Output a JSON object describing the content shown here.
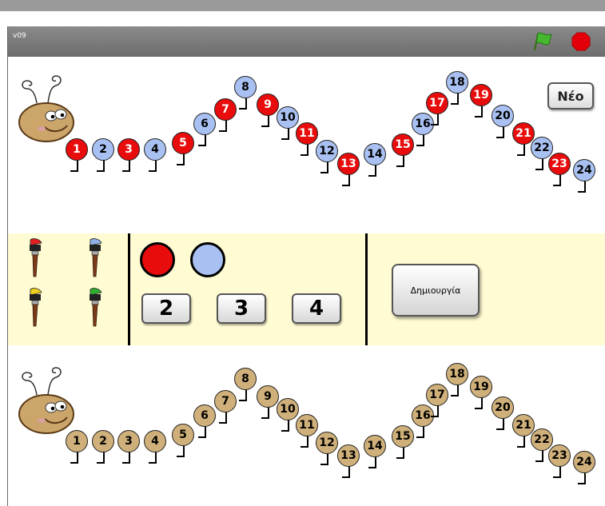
{
  "window": {
    "version": "v09"
  },
  "controls": {
    "green_flag_icon": "green-flag-icon",
    "stop_icon": "stop-sign-icon",
    "neo_label": "Νέο"
  },
  "palette": {
    "brush_colors": [
      "#e02020",
      "#8fb0e8",
      "#f0d020",
      "#30b030"
    ],
    "swatch_colors": [
      "#e80c0c",
      "#a9c1f2"
    ],
    "number_buttons": [
      "2",
      "3",
      "4"
    ],
    "create_label": "Δημιουργία"
  },
  "caterpillar_top": {
    "segments": [
      {
        "n": "1",
        "color": "red"
      },
      {
        "n": "2",
        "color": "blue"
      },
      {
        "n": "3",
        "color": "red"
      },
      {
        "n": "4",
        "color": "blue"
      },
      {
        "n": "5",
        "color": "red"
      },
      {
        "n": "6",
        "color": "blue"
      },
      {
        "n": "7",
        "color": "red"
      },
      {
        "n": "8",
        "color": "blue"
      },
      {
        "n": "9",
        "color": "red"
      },
      {
        "n": "10",
        "color": "blue"
      },
      {
        "n": "11",
        "color": "red"
      },
      {
        "n": "12",
        "color": "blue"
      },
      {
        "n": "13",
        "color": "red"
      },
      {
        "n": "14",
        "color": "blue"
      },
      {
        "n": "15",
        "color": "red"
      },
      {
        "n": "16",
        "color": "blue"
      },
      {
        "n": "17",
        "color": "red"
      },
      {
        "n": "18",
        "color": "blue"
      },
      {
        "n": "19",
        "color": "red"
      },
      {
        "n": "20",
        "color": "blue"
      },
      {
        "n": "21",
        "color": "red"
      },
      {
        "n": "22",
        "color": "blue"
      },
      {
        "n": "23",
        "color": "red"
      },
      {
        "n": "24",
        "color": "blue"
      }
    ]
  },
  "caterpillar_bottom": {
    "segments": [
      {
        "n": "1",
        "color": "tan"
      },
      {
        "n": "2",
        "color": "tan"
      },
      {
        "n": "3",
        "color": "tan"
      },
      {
        "n": "4",
        "color": "tan"
      },
      {
        "n": "5",
        "color": "tan"
      },
      {
        "n": "6",
        "color": "tan"
      },
      {
        "n": "7",
        "color": "tan"
      },
      {
        "n": "8",
        "color": "tan"
      },
      {
        "n": "9",
        "color": "tan"
      },
      {
        "n": "10",
        "color": "tan"
      },
      {
        "n": "11",
        "color": "tan"
      },
      {
        "n": "12",
        "color": "tan"
      },
      {
        "n": "13",
        "color": "tan"
      },
      {
        "n": "14",
        "color": "tan"
      },
      {
        "n": "15",
        "color": "tan"
      },
      {
        "n": "16",
        "color": "tan"
      },
      {
        "n": "17",
        "color": "tan"
      },
      {
        "n": "18",
        "color": "tan"
      },
      {
        "n": "19",
        "color": "tan"
      },
      {
        "n": "20",
        "color": "tan"
      },
      {
        "n": "21",
        "color": "tan"
      },
      {
        "n": "22",
        "color": "tan"
      },
      {
        "n": "23",
        "color": "tan"
      },
      {
        "n": "24",
        "color": "tan"
      }
    ]
  },
  "colors": {
    "red": "#e80c0c",
    "blue": "#a9c1f2",
    "tan": "#cfb07a",
    "panel": "#fffbd2"
  }
}
